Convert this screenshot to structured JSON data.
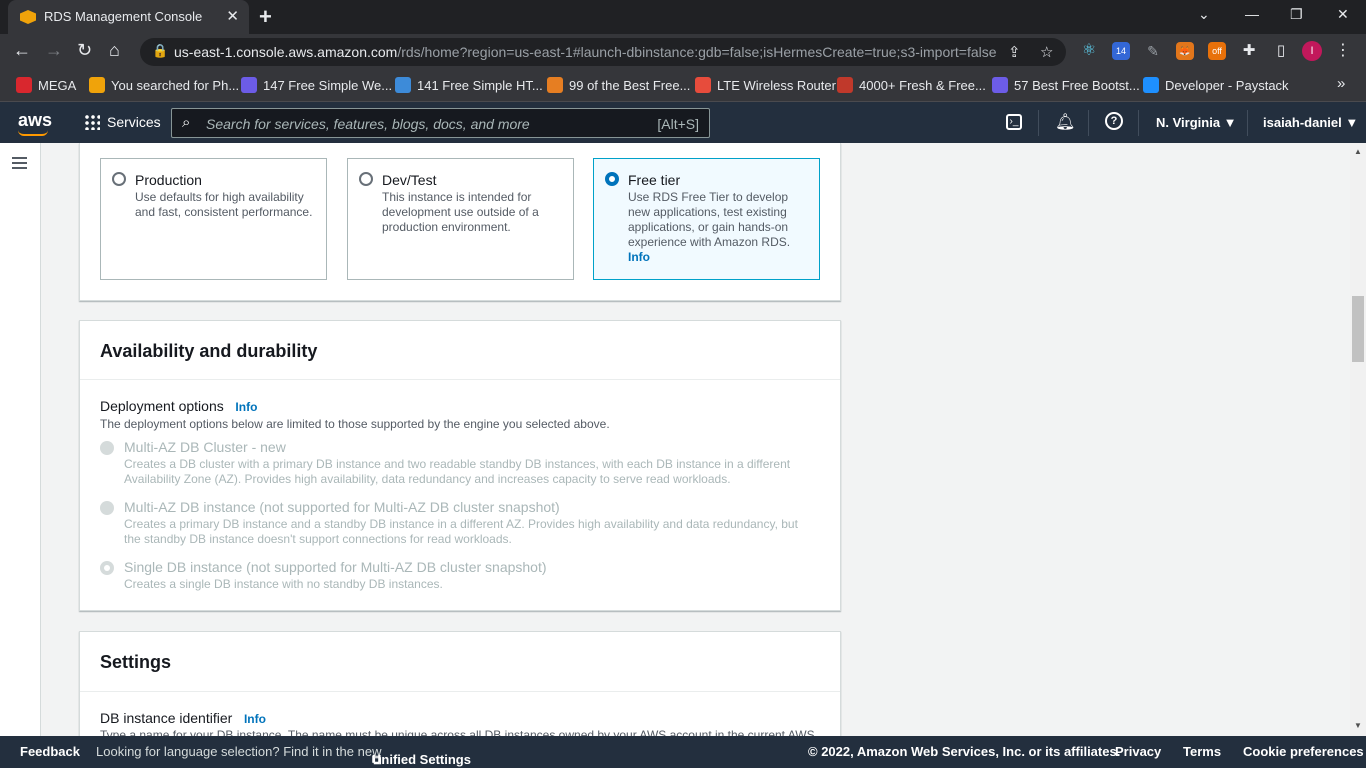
{
  "browser": {
    "tab_title": "RDS Management Console",
    "tab_close": "✕",
    "new_tab": "+",
    "url_host": "us-east-1.console.aws.amazon.com",
    "url_path": "/rds/home?region=us-east-1#launch-dbinstance:gdb=false;isHermesCreate=true;s3-import=false",
    "bookmarks": [
      {
        "label": "MEGA",
        "color": "#d9272e"
      },
      {
        "label": "You searched for Ph...",
        "color": "#f0a30a"
      },
      {
        "label": "147 Free Simple We...",
        "color": "#6c5ce7"
      },
      {
        "label": "141 Free Simple HT...",
        "color": "#3d8bd9"
      },
      {
        "label": "99 of the Best Free...",
        "color": "#e67e22"
      },
      {
        "label": "LTE Wireless Router",
        "color": "#e74c3c"
      },
      {
        "label": "4000+ Fresh & Free...",
        "color": "#c0392b"
      },
      {
        "label": "57 Best Free Bootst...",
        "color": "#6c5ce7"
      },
      {
        "label": "Developer - Paystack",
        "color": "#1e90ff"
      }
    ],
    "ext_badge_1": "14",
    "ext_badge_2": "off",
    "profile_initial": "I",
    "more": "»"
  },
  "aws_header": {
    "logo": "aws",
    "services": "Services",
    "search_placeholder": "Search for services, features, blogs, docs, and more",
    "search_shortcut": "[Alt+S]",
    "region": "N. Virginia ▼",
    "user": "isaiah-daniel ▼"
  },
  "templates": {
    "cards": [
      {
        "title": "Production",
        "desc": "Use defaults for high availability and fast, consistent performance.",
        "selected": false
      },
      {
        "title": "Dev/Test",
        "desc": "This instance is intended for development use outside of a production environment.",
        "selected": false
      },
      {
        "title": "Free tier",
        "desc": "Use RDS Free Tier to develop new applications, test existing applications, or gain hands-on experience with Amazon RDS.",
        "info": "Info",
        "selected": true
      }
    ]
  },
  "availability": {
    "heading": "Availability and durability",
    "deployment_label": "Deployment options",
    "info": "Info",
    "deployment_desc": "The deployment options below are limited to those supported by the engine you selected above.",
    "options": [
      {
        "title": "Multi-AZ DB Cluster - new",
        "desc": "Creates a DB cluster with a primary DB instance and two readable standby DB instances, with each DB instance in a different Availability Zone (AZ). Provides high availability, data redundancy and increases capacity to serve read workloads."
      },
      {
        "title": "Multi-AZ DB instance (not supported for Multi-AZ DB cluster snapshot)",
        "desc": "Creates a primary DB instance and a standby DB instance in a different AZ. Provides high availability and data redundancy, but the standby DB instance doesn't support connections for read workloads."
      },
      {
        "title": "Single DB instance (not supported for Multi-AZ DB cluster snapshot)",
        "desc": "Creates a single DB instance with no standby DB instances."
      }
    ]
  },
  "settings": {
    "heading": "Settings",
    "identifier_label": "DB instance identifier",
    "info": "Info",
    "identifier_desc": "Type a name for your DB instance. The name must be unique across all DB instances owned by your AWS account in the current AWS"
  },
  "footer": {
    "feedback": "Feedback",
    "language_text": "Looking for language selection? Find it in the new",
    "unified_settings": "Unified Settings",
    "copyright": "© 2022, Amazon Web Services, Inc. or its affiliates.",
    "privacy": "Privacy",
    "terms": "Terms",
    "cookies": "Cookie preferences"
  }
}
